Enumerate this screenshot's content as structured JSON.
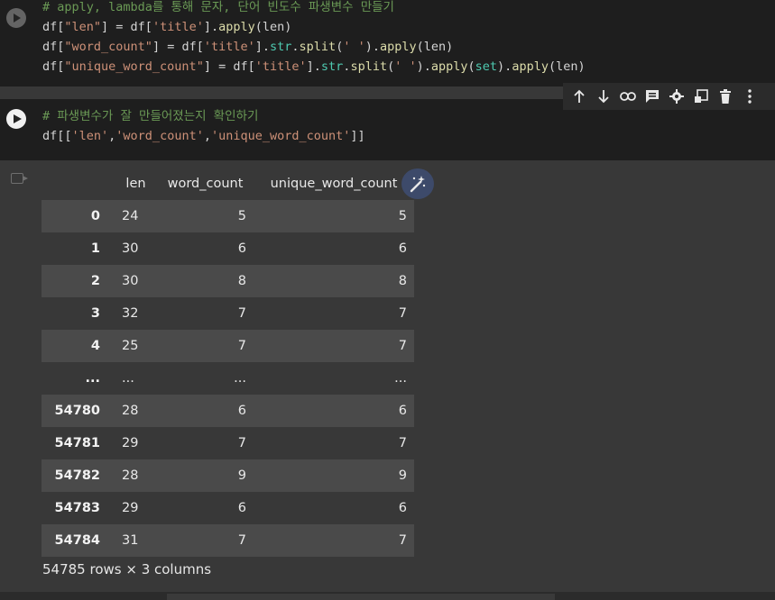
{
  "cell1": {
    "lines": [
      {
        "parts": [
          {
            "t": "# apply, lambda를 통해 문자, 단어 빈도수 파생변수 만들기",
            "c": "c-comment"
          }
        ]
      },
      {
        "parts": [
          {
            "t": "df[",
            "c": "c-punc"
          },
          {
            "t": "\"len\"",
            "c": "c-str"
          },
          {
            "t": "] = df[",
            "c": "c-punc"
          },
          {
            "t": "'title'",
            "c": "c-str"
          },
          {
            "t": "].",
            "c": "c-punc"
          },
          {
            "t": "apply",
            "c": "c-fn"
          },
          {
            "t": "(len)",
            "c": "c-punc"
          }
        ]
      },
      {
        "parts": [
          {
            "t": "df[",
            "c": "c-punc"
          },
          {
            "t": "\"word_count\"",
            "c": "c-str"
          },
          {
            "t": "] = df[",
            "c": "c-punc"
          },
          {
            "t": "'title'",
            "c": "c-str"
          },
          {
            "t": "].",
            "c": "c-punc"
          },
          {
            "t": "str",
            "c": "c-kw"
          },
          {
            "t": ".",
            "c": "c-punc"
          },
          {
            "t": "split",
            "c": "c-fn"
          },
          {
            "t": "(",
            "c": "c-punc"
          },
          {
            "t": "' '",
            "c": "c-str"
          },
          {
            "t": ").",
            "c": "c-punc"
          },
          {
            "t": "apply",
            "c": "c-fn"
          },
          {
            "t": "(len)",
            "c": "c-punc"
          }
        ]
      },
      {
        "parts": [
          {
            "t": "df[",
            "c": "c-punc"
          },
          {
            "t": "\"unique_word_count\"",
            "c": "c-str"
          },
          {
            "t": "] = df[",
            "c": "c-punc"
          },
          {
            "t": "'title'",
            "c": "c-str"
          },
          {
            "t": "].",
            "c": "c-punc"
          },
          {
            "t": "str",
            "c": "c-kw"
          },
          {
            "t": ".",
            "c": "c-punc"
          },
          {
            "t": "split",
            "c": "c-fn"
          },
          {
            "t": "(",
            "c": "c-punc"
          },
          {
            "t": "' '",
            "c": "c-str"
          },
          {
            "t": ").",
            "c": "c-punc"
          },
          {
            "t": "apply",
            "c": "c-fn"
          },
          {
            "t": "(",
            "c": "c-punc"
          },
          {
            "t": "set",
            "c": "c-kw"
          },
          {
            "t": ").",
            "c": "c-punc"
          },
          {
            "t": "apply",
            "c": "c-fn"
          },
          {
            "t": "(len)",
            "c": "c-punc"
          }
        ]
      }
    ]
  },
  "cell2": {
    "lines": [
      {
        "parts": [
          {
            "t": "# 파생변수가 잘 만들어졌는지 확인하기",
            "c": "c-comment"
          }
        ]
      },
      {
        "parts": [
          {
            "t": "df[[",
            "c": "c-punc"
          },
          {
            "t": "'len'",
            "c": "c-str"
          },
          {
            "t": ",",
            "c": "c-punc"
          },
          {
            "t": "'word_count'",
            "c": "c-str"
          },
          {
            "t": ",",
            "c": "c-punc"
          },
          {
            "t": "'unique_word_count'",
            "c": "c-str"
          },
          {
            "t": "]]",
            "c": "c-punc"
          }
        ]
      }
    ]
  },
  "toolbar": {
    "icons": [
      "arrow-up-icon",
      "arrow-down-icon",
      "link-icon",
      "comment-icon",
      "gear-icon",
      "mirror-icon",
      "trash-icon",
      "more-vert-icon"
    ]
  },
  "table": {
    "columns": [
      "len",
      "word_count",
      "unique_word_count"
    ],
    "rows": [
      {
        "index": "0",
        "len": "24",
        "wc": "5",
        "uwc": "5"
      },
      {
        "index": "1",
        "len": "30",
        "wc": "6",
        "uwc": "6"
      },
      {
        "index": "2",
        "len": "30",
        "wc": "8",
        "uwc": "8"
      },
      {
        "index": "3",
        "len": "32",
        "wc": "7",
        "uwc": "7"
      },
      {
        "index": "4",
        "len": "25",
        "wc": "7",
        "uwc": "7"
      },
      {
        "index": "...",
        "len": "...",
        "wc": "...",
        "uwc": "..."
      },
      {
        "index": "54780",
        "len": "28",
        "wc": "6",
        "uwc": "6"
      },
      {
        "index": "54781",
        "len": "29",
        "wc": "7",
        "uwc": "7"
      },
      {
        "index": "54782",
        "len": "28",
        "wc": "9",
        "uwc": "9"
      },
      {
        "index": "54783",
        "len": "29",
        "wc": "6",
        "uwc": "6"
      },
      {
        "index": "54784",
        "len": "31",
        "wc": "7",
        "uwc": "7"
      }
    ],
    "shape": "54785 rows × 3 columns"
  },
  "colors": {
    "editor_bg": "#1e1e1e",
    "output_bg": "#383838",
    "row_stripe": "#4a4a4a",
    "comment": "#6a9955",
    "string": "#ce9178",
    "function": "#dcdcaa",
    "keyword": "#4ec9b0"
  }
}
